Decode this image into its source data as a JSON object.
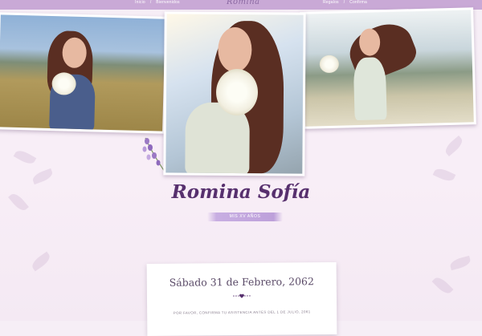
{
  "nav": {
    "left": [
      "Inicio",
      "Bienvenidos"
    ],
    "right": [
      "Regalos",
      "Confirma"
    ],
    "separator": "/",
    "logo": "Romina"
  },
  "hero": {
    "name": "Romina Sofía",
    "ribbon": "MIS XV AÑOS"
  },
  "event": {
    "date": "Sábado 31 de Febrero, 2062",
    "note": "POR FAVOR, CONFIRMA TU ASISTENCIA ANTES DEL 1 DE JULIO, 2061"
  },
  "colors": {
    "accent": "#57306e",
    "topbar": "#c9a9d6",
    "ribbon": "#bda0da"
  },
  "icons": [
    "heart-icon",
    "lavender-sprig-icon"
  ]
}
